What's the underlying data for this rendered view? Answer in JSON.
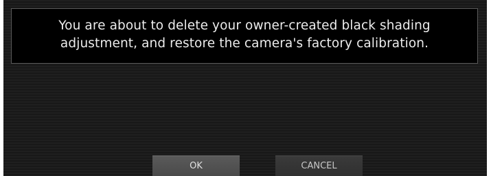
{
  "dialog": {
    "message_line1": "You are about to delete your owner-created black shading",
    "message_line2": "adjustment, and restore the camera's factory calibration."
  },
  "buttons": {
    "ok_label": "OK",
    "cancel_label": "CANCEL"
  },
  "colors": {
    "background": "#1c1c1c",
    "message_box": "#000000",
    "text": "#ececec",
    "ok_button": "#525252",
    "cancel_button": "#353535"
  }
}
